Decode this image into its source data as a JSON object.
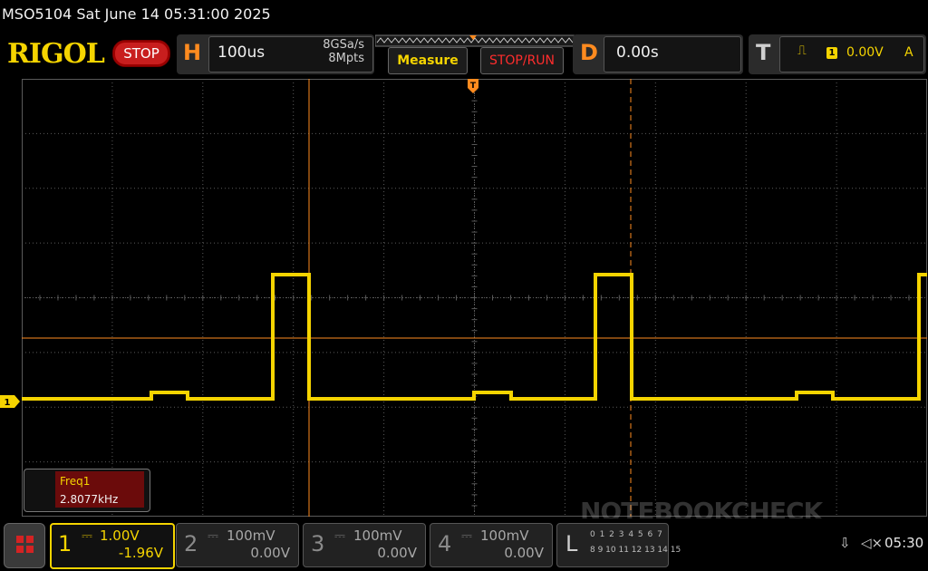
{
  "title": "MSO5104  Sat June 14 05:31:00 2025",
  "logo": "RIGOL",
  "run_state": "STOP",
  "horizontal": {
    "letter": "H",
    "timebase": "100us",
    "sample_rate": "8GSa/s",
    "memory_depth": "8Mpts"
  },
  "buttons": {
    "measure": "Measure",
    "stop_run": "STOP/RUN"
  },
  "delay": {
    "letter": "D",
    "value": "0.00s"
  },
  "trigger": {
    "letter": "T",
    "slope": "⎍",
    "source": "1",
    "level": "0.00V",
    "mode": "A"
  },
  "measurement": {
    "name": "Freq1",
    "value": "2.8077kHz"
  },
  "channels": [
    {
      "number": "1",
      "scale": "1.00V",
      "offset": "-1.96V",
      "color": "#f5d400"
    },
    {
      "number": "2",
      "scale": "100mV",
      "offset": "0.00V",
      "color": "#8a8a8a"
    },
    {
      "number": "3",
      "scale": "100mV",
      "offset": "0.00V",
      "color": "#8a8a8a"
    },
    {
      "number": "4",
      "scale": "100mV",
      "offset": "0.00V",
      "color": "#8a8a8a"
    }
  ],
  "logic": {
    "letter": "L",
    "bits_row1": "0 1 2 3 4 5 6 7",
    "bits_row2": "8 9 10 11 12 13 14 15"
  },
  "ch1_marker": "1",
  "trigger_marker": "T",
  "status": {
    "time": "05:30"
  },
  "watermark": "NOTEBOOKCHECK",
  "colors": {
    "trace": "#f5d400",
    "cursor": "#ff8b1f",
    "grid": "#5a5a5a",
    "stop": "#c81e1e"
  }
}
